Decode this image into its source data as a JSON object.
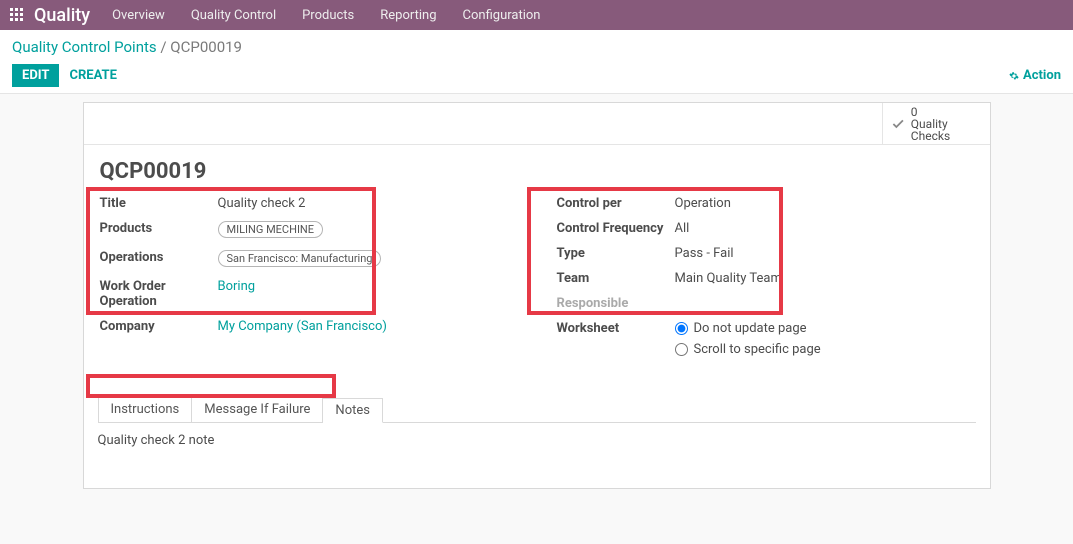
{
  "topnav": {
    "brand": "Quality",
    "menus": [
      "Overview",
      "Quality Control",
      "Products",
      "Reporting",
      "Configuration"
    ]
  },
  "breadcrumb": {
    "link": "Quality Control Points",
    "sep": " / ",
    "current": "QCP00019"
  },
  "buttons": {
    "edit": "EDIT",
    "create": "CREATE",
    "action": "Action"
  },
  "statbutton": {
    "count": "0",
    "label": "Quality Checks"
  },
  "record_name": "QCP00019",
  "left": {
    "title_label": "Title",
    "title_value": "Quality check 2",
    "products_label": "Products",
    "products_tag": "MILING MECHINE",
    "operations_label": "Operations",
    "operations_tag": "San Francisco: Manufacturing",
    "workorder_label": "Work Order Operation",
    "workorder_value": "Boring",
    "company_label": "Company",
    "company_value": "My Company (San Francisco)"
  },
  "right": {
    "controlper_label": "Control per",
    "controlper_value": "Operation",
    "freq_label": "Control Frequency",
    "freq_value": "All",
    "type_label": "Type",
    "type_value": "Pass - Fail",
    "team_label": "Team",
    "team_value": "Main Quality Team",
    "responsible_label": "Responsible",
    "worksheet_label": "Worksheet",
    "worksheet_opt1": "Do not update page",
    "worksheet_opt2": "Scroll to specific page"
  },
  "tabs": {
    "instructions": "Instructions",
    "failure": "Message If Failure",
    "notes": "Notes",
    "notes_content": "Quality check 2  note"
  }
}
